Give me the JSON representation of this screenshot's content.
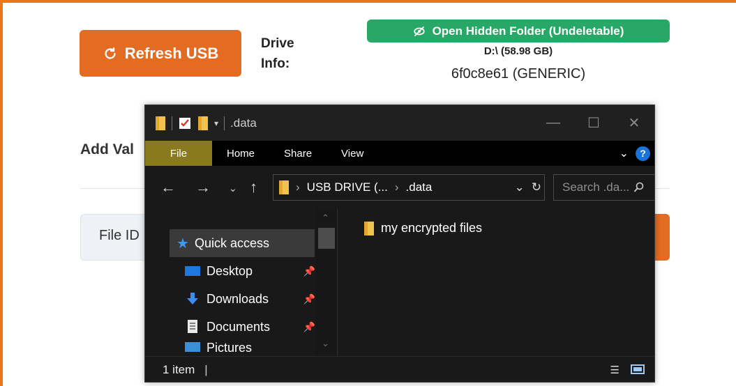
{
  "app": {
    "refresh_label": "Refresh USB",
    "drive_info_label": "Drive Info:",
    "hidden_folder_label": "Open Hidden Folder (Undeletable)",
    "drive_letter": "D:\\ (58.98 GB)",
    "drive_serial": "6f0c8e61 (GENERIC)",
    "add_section_title": "Add Val",
    "file_id_label": "File ID",
    "accent_color": "#e46c22",
    "success_color": "#28a866"
  },
  "explorer": {
    "title": ".data",
    "ribbon_tabs": [
      "File",
      "Home",
      "Share",
      "View"
    ],
    "address_root": "USB DRIVE (...",
    "address_folder": ".data",
    "search_placeholder": "Search .da...",
    "nav_items": [
      {
        "label": "Quick access",
        "icon": "star-icon"
      },
      {
        "label": "Desktop",
        "icon": "desktop-icon"
      },
      {
        "label": "Downloads",
        "icon": "download-icon"
      },
      {
        "label": "Documents",
        "icon": "document-icon"
      },
      {
        "label": "Pictures",
        "icon": "pictures-icon"
      }
    ],
    "files": [
      {
        "name": "my encrypted files",
        "icon": "folder-icon"
      }
    ],
    "status_count": "1 item",
    "help_label": "?"
  }
}
